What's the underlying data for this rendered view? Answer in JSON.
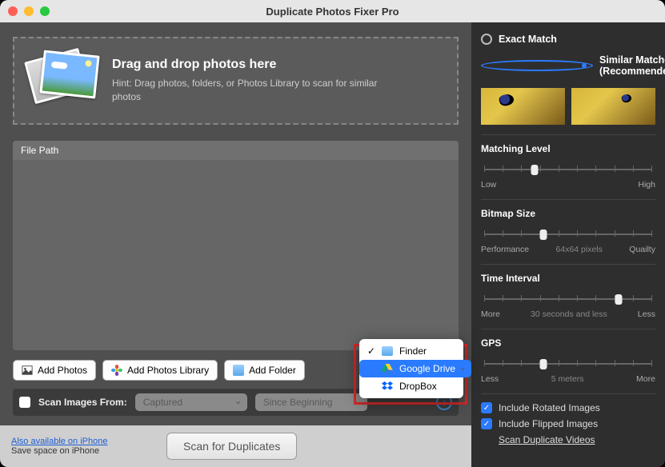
{
  "window": {
    "title": "Duplicate Photos Fixer Pro"
  },
  "dropzone": {
    "heading": "Drag and drop photos here",
    "hint": "Hint: Drag photos, folders, or Photos Library to scan for similar photos"
  },
  "filepath": {
    "header": "File Path"
  },
  "buttons": {
    "add_photos": "Add Photos",
    "add_library": "Add Photos Library",
    "add_folder": "Add Folder"
  },
  "scanfrom": {
    "label": "Scan Images From:",
    "select1": "Captured",
    "select2": "Since Beginning"
  },
  "source_menu": {
    "items": [
      {
        "label": "Finder",
        "checked": true,
        "selected": false
      },
      {
        "label": "Google Drive",
        "checked": false,
        "selected": true
      },
      {
        "label": "DropBox",
        "checked": false,
        "selected": false
      }
    ]
  },
  "footer": {
    "link": "Also available on iPhone",
    "sub": "Save space on iPhone",
    "scan": "Scan for Duplicates"
  },
  "rpanel": {
    "exact": "Exact Match",
    "similar": "Similar Matches (Recommended)",
    "matching": {
      "title": "Matching Level",
      "left": "Low",
      "right": "High",
      "pos": 30
    },
    "bitmap": {
      "title": "Bitmap Size",
      "left": "Performance",
      "mid": "64x64 pixels",
      "right": "Quailty",
      "pos": 35
    },
    "time": {
      "title": "Time Interval",
      "left": "More",
      "mid": "30 seconds and less",
      "right": "Less",
      "pos": 80
    },
    "gps": {
      "title": "GPS",
      "left": "Less",
      "mid": "5 meters",
      "right": "More",
      "pos": 35
    },
    "rotated": "Include Rotated Images",
    "flipped": "Include Flipped Images",
    "videos": "Scan Duplicate Videos"
  }
}
